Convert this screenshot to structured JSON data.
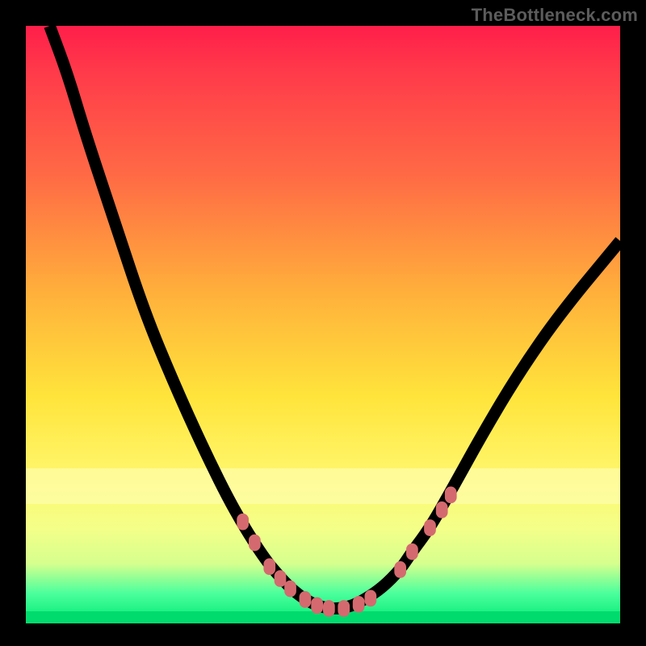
{
  "watermark": "TheBottleneck.com",
  "colors": {
    "frame": "#000000",
    "marker": "#d46a6f",
    "curve": "#000000",
    "gradient_top": "#ff1e4a",
    "gradient_bottom": "#00e874"
  },
  "chart_data": {
    "type": "line",
    "title": "",
    "xlabel": "",
    "ylabel": "",
    "xlim": [
      0,
      100
    ],
    "ylim": [
      0,
      100
    ],
    "grid": false,
    "legend": false,
    "note": "Bottleneck-style V curve. Values are read off the plot area as percentage coordinates (x left→right, y bottom→top). The line is drawn over a vertical rainbow gradient and the V minimum sits near the green band (optimal / no-bottleneck zone).",
    "series": [
      {
        "name": "curve",
        "x": [
          4,
          7,
          10,
          15,
          20,
          25,
          30,
          35,
          40,
          43,
          45,
          47,
          49,
          51,
          53,
          55,
          57,
          60,
          63,
          65,
          68,
          72,
          77,
          83,
          90,
          100
        ],
        "y": [
          100,
          92,
          82,
          67,
          52,
          40,
          29,
          19,
          11,
          7.5,
          5.5,
          4,
          3,
          2.5,
          2.5,
          3,
          4,
          6,
          9,
          12,
          16,
          23,
          32,
          42,
          52,
          64
        ]
      }
    ],
    "markers": {
      "name": "highlighted-points",
      "points": [
        {
          "x": 36.5,
          "y": 17
        },
        {
          "x": 38.5,
          "y": 13.5
        },
        {
          "x": 41,
          "y": 9.5
        },
        {
          "x": 42.8,
          "y": 7.5
        },
        {
          "x": 44.5,
          "y": 5.8
        },
        {
          "x": 47,
          "y": 4
        },
        {
          "x": 49,
          "y": 3
        },
        {
          "x": 51,
          "y": 2.5
        },
        {
          "x": 53.5,
          "y": 2.5
        },
        {
          "x": 56,
          "y": 3.2
        },
        {
          "x": 58,
          "y": 4.2
        },
        {
          "x": 63,
          "y": 9
        },
        {
          "x": 65,
          "y": 12
        },
        {
          "x": 68,
          "y": 16
        },
        {
          "x": 70,
          "y": 19
        },
        {
          "x": 71.5,
          "y": 21.5
        }
      ]
    },
    "bands": [
      {
        "name": "light-band",
        "y_from": 20,
        "y_to": 26
      },
      {
        "name": "deep-green-min",
        "y_from": 0,
        "y_to": 2
      }
    ]
  }
}
